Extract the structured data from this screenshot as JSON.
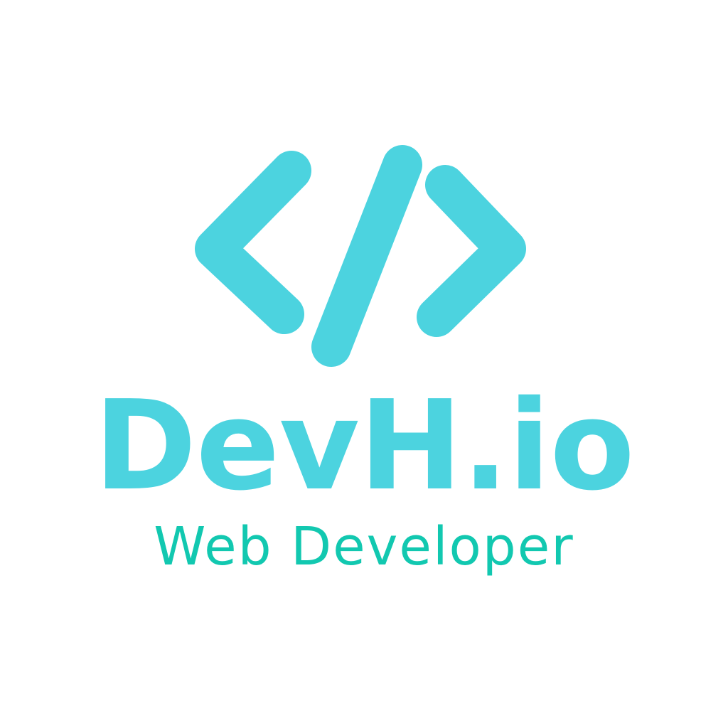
{
  "logo": {
    "icon": "code-brackets-icon",
    "brand_name": "DevH.io",
    "tagline": "Web Developer",
    "colors": {
      "icon": "#4cd3df",
      "brand_name": "#4cd3df",
      "tagline": "#12c8b0",
      "background": "#ffffff"
    }
  }
}
